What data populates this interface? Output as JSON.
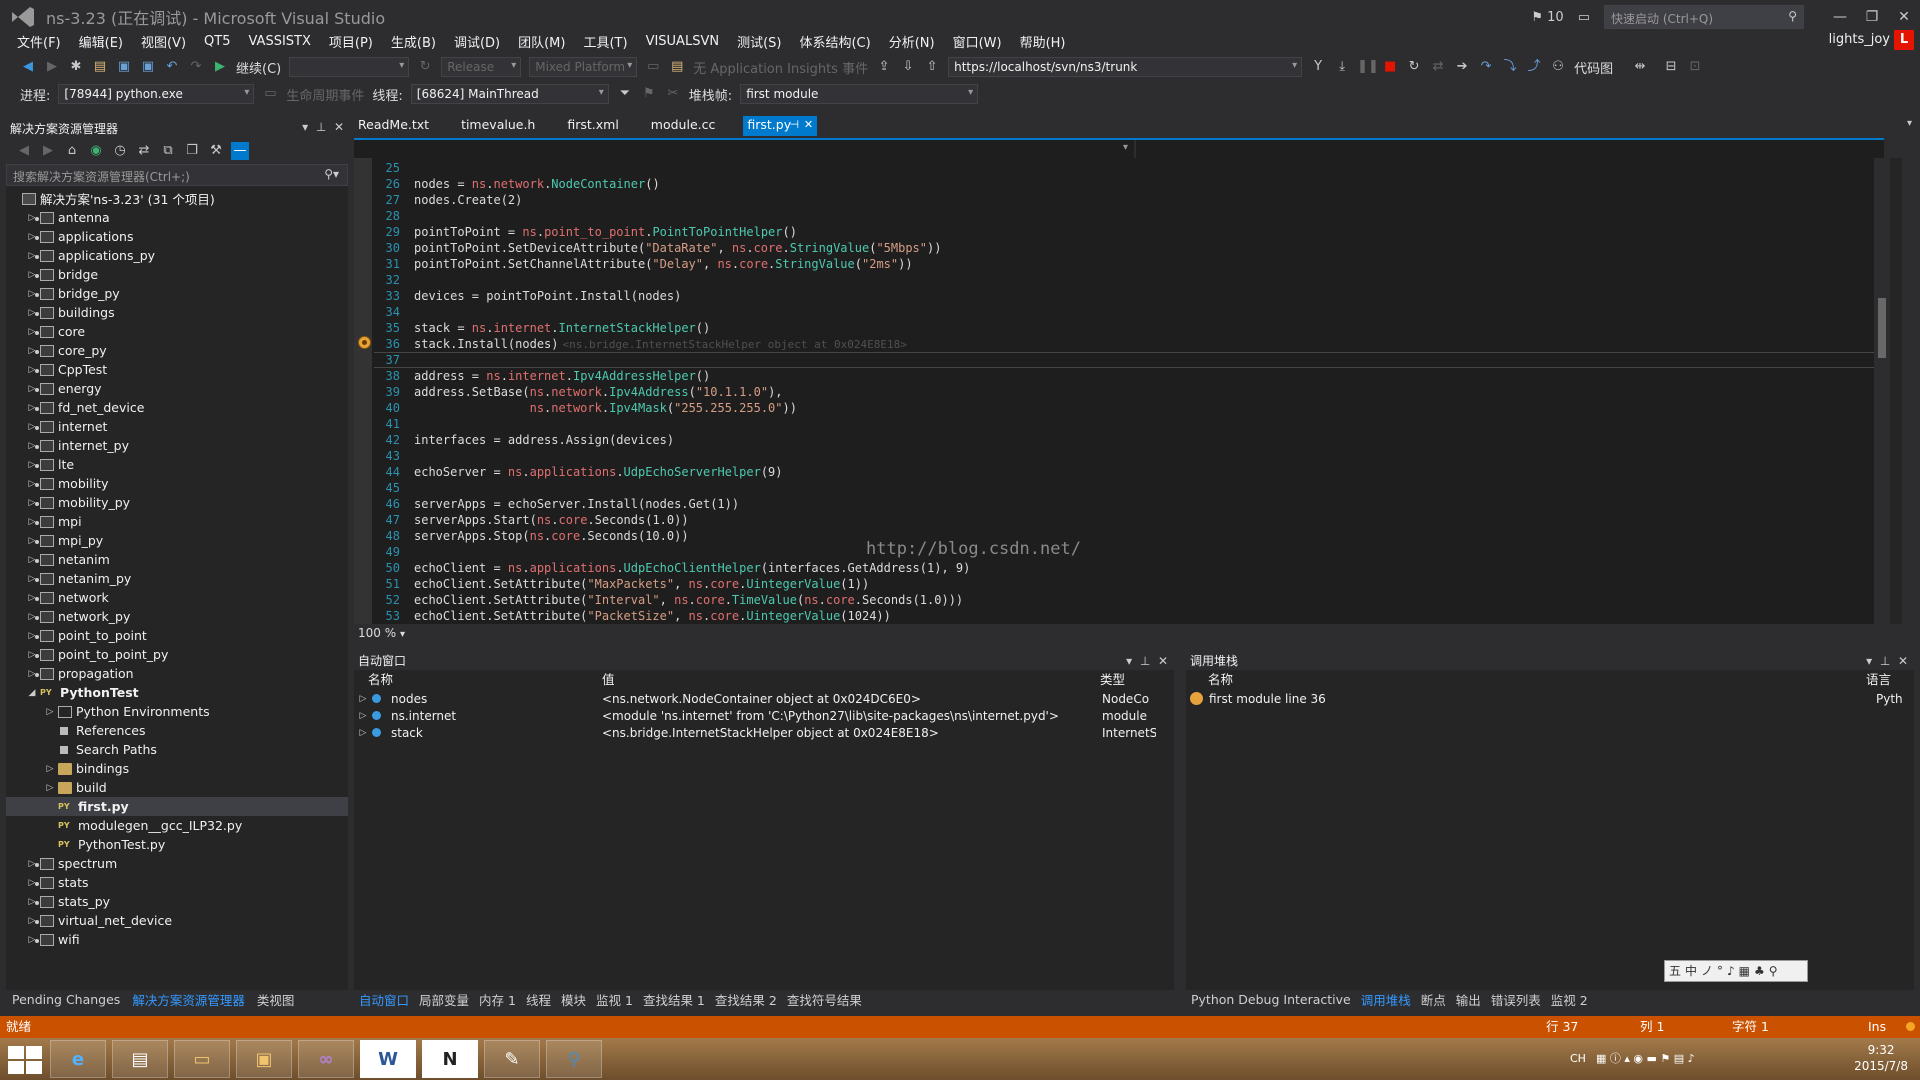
{
  "window": {
    "title": "ns-3.23 (正在调试) - Microsoft Visual Studio",
    "notifications": "10",
    "quick_launch_placeholder": "快速启动 (Ctrl+Q)",
    "user": "lights_joy",
    "user_badge": "L"
  },
  "menu": [
    "文件(F)",
    "编辑(E)",
    "视图(V)",
    "QT5",
    "VASSISTX",
    "项目(P)",
    "生成(B)",
    "调试(D)",
    "团队(M)",
    "工具(T)",
    "VISUALSVN",
    "测试(S)",
    "体系结构(C)",
    "分析(N)",
    "窗口(W)",
    "帮助(H)"
  ],
  "toolbar1": {
    "continue_label": "继续(C)",
    "config": "Release",
    "platform": "Mixed Platform",
    "insights": "无 Application Insights 事件",
    "svn_url": "https://localhost/svn/ns3/trunk",
    "code_map": "代码图"
  },
  "toolbar2": {
    "process_label": "进程:",
    "process_value": "[78944] python.exe",
    "lifecycle": "生命周期事件",
    "thread_label": "线程:",
    "thread_value": "[68624] MainThread",
    "stackframe_label": "堆栈帧:",
    "stackframe_value": "first module"
  },
  "solution_explorer": {
    "title": "解决方案资源管理器",
    "search_placeholder": "搜索解决方案资源管理器(Ctrl+;)",
    "items": [
      {
        "label": "解决方案'ns-3.23' (31 个项目)",
        "level": 0,
        "icon": "sol",
        "exp": ""
      },
      {
        "label": "antenna",
        "level": 1,
        "icon": "proj",
        "exp": "▷"
      },
      {
        "label": "applications",
        "level": 1,
        "icon": "proj",
        "exp": "▷"
      },
      {
        "label": "applications_py",
        "level": 1,
        "icon": "proj",
        "exp": "▷"
      },
      {
        "label": "bridge",
        "level": 1,
        "icon": "proj",
        "exp": "▷"
      },
      {
        "label": "bridge_py",
        "level": 1,
        "icon": "proj",
        "exp": "▷"
      },
      {
        "label": "buildings",
        "level": 1,
        "icon": "proj",
        "exp": "▷"
      },
      {
        "label": "core",
        "level": 1,
        "icon": "proj",
        "exp": "▷"
      },
      {
        "label": "core_py",
        "level": 1,
        "icon": "proj",
        "exp": "▷"
      },
      {
        "label": "CppTest",
        "level": 1,
        "icon": "proj",
        "exp": "▷"
      },
      {
        "label": "energy",
        "level": 1,
        "icon": "proj",
        "exp": "▷"
      },
      {
        "label": "fd_net_device",
        "level": 1,
        "icon": "proj",
        "exp": "▷"
      },
      {
        "label": "internet",
        "level": 1,
        "icon": "proj",
        "exp": "▷"
      },
      {
        "label": "internet_py",
        "level": 1,
        "icon": "proj",
        "exp": "▷"
      },
      {
        "label": "lte",
        "level": 1,
        "icon": "proj",
        "exp": "▷"
      },
      {
        "label": "mobility",
        "level": 1,
        "icon": "proj",
        "exp": "▷"
      },
      {
        "label": "mobility_py",
        "level": 1,
        "icon": "proj",
        "exp": "▷"
      },
      {
        "label": "mpi",
        "level": 1,
        "icon": "proj",
        "exp": "▷"
      },
      {
        "label": "mpi_py",
        "level": 1,
        "icon": "proj",
        "exp": "▷"
      },
      {
        "label": "netanim",
        "level": 1,
        "icon": "proj",
        "exp": "▷"
      },
      {
        "label": "netanim_py",
        "level": 1,
        "icon": "proj",
        "exp": "▷"
      },
      {
        "label": "network",
        "level": 1,
        "icon": "proj",
        "exp": "▷"
      },
      {
        "label": "network_py",
        "level": 1,
        "icon": "proj",
        "exp": "▷"
      },
      {
        "label": "point_to_point",
        "level": 1,
        "icon": "proj",
        "exp": "▷"
      },
      {
        "label": "point_to_point_py",
        "level": 1,
        "icon": "proj",
        "exp": "▷"
      },
      {
        "label": "propagation",
        "level": 1,
        "icon": "proj",
        "exp": "▷"
      },
      {
        "label": "PythonTest",
        "level": 1,
        "icon": "py",
        "exp": "◢",
        "bold": true
      },
      {
        "label": "Python Environments",
        "level": 2,
        "icon": "env",
        "exp": "▷"
      },
      {
        "label": "References",
        "level": 2,
        "icon": "ref",
        "exp": ""
      },
      {
        "label": "Search Paths",
        "level": 2,
        "icon": "ref",
        "exp": ""
      },
      {
        "label": "bindings",
        "level": 2,
        "icon": "folder",
        "exp": "▷"
      },
      {
        "label": "build",
        "level": 2,
        "icon": "folder",
        "exp": "▷"
      },
      {
        "label": "first.py",
        "level": 2,
        "icon": "py",
        "exp": "",
        "bold": true,
        "selected": true
      },
      {
        "label": "modulegen__gcc_ILP32.py",
        "level": 2,
        "icon": "py",
        "exp": ""
      },
      {
        "label": "PythonTest.py",
        "level": 2,
        "icon": "py",
        "exp": ""
      },
      {
        "label": "spectrum",
        "level": 1,
        "icon": "proj",
        "exp": "▷"
      },
      {
        "label": "stats",
        "level": 1,
        "icon": "proj",
        "exp": "▷"
      },
      {
        "label": "stats_py",
        "level": 1,
        "icon": "proj",
        "exp": "▷"
      },
      {
        "label": "virtual_net_device",
        "level": 1,
        "icon": "proj",
        "exp": "▷"
      },
      {
        "label": "wifi",
        "level": 1,
        "icon": "proj",
        "exp": "▷"
      }
    ],
    "tabs": [
      "Pending Changes",
      "解决方案资源管理器",
      "类视图"
    ],
    "active_tab": 1
  },
  "editor": {
    "tabs": [
      "ReadMe.txt",
      "timevalue.h",
      "first.xml",
      "module.cc",
      "first.py"
    ],
    "active_tab": 4,
    "zoom": "100 %",
    "current_line": 36,
    "tooltip": "<ns.bridge.InternetStackHelper object at 0x024E8E18>",
    "watermark": "http://blog.csdn.net/",
    "lines": [
      {
        "n": "25",
        "t": ""
      },
      {
        "n": "26",
        "t": "nodes = ns.network.NodeContainer()"
      },
      {
        "n": "27",
        "t": "nodes.Create(2)"
      },
      {
        "n": "28",
        "t": ""
      },
      {
        "n": "29",
        "t": "pointToPoint = ns.point_to_point.PointToPointHelper()"
      },
      {
        "n": "30",
        "t": "pointToPoint.SetDeviceAttribute(\"DataRate\", ns.core.StringValue(\"5Mbps\"))"
      },
      {
        "n": "31",
        "t": "pointToPoint.SetChannelAttribute(\"Delay\", ns.core.StringValue(\"2ms\"))"
      },
      {
        "n": "32",
        "t": ""
      },
      {
        "n": "33",
        "t": "devices = pointToPoint.Install(nodes)"
      },
      {
        "n": "34",
        "t": ""
      },
      {
        "n": "35",
        "t": "stack = ns.internet.InternetStackHelper()"
      },
      {
        "n": "36",
        "t": "stack.Install(nodes)"
      },
      {
        "n": "37",
        "t": ""
      },
      {
        "n": "38",
        "t": "address = ns.internet.Ipv4AddressHelper()"
      },
      {
        "n": "39",
        "t": "address.SetBase(ns.network.Ipv4Address(\"10.1.1.0\"),"
      },
      {
        "n": "40",
        "t": "                ns.network.Ipv4Mask(\"255.255.255.0\"))"
      },
      {
        "n": "41",
        "t": ""
      },
      {
        "n": "42",
        "t": "interfaces = address.Assign(devices)"
      },
      {
        "n": "43",
        "t": ""
      },
      {
        "n": "44",
        "t": "echoServer = ns.applications.UdpEchoServerHelper(9)"
      },
      {
        "n": "45",
        "t": ""
      },
      {
        "n": "46",
        "t": "serverApps = echoServer.Install(nodes.Get(1))"
      },
      {
        "n": "47",
        "t": "serverApps.Start(ns.core.Seconds(1.0))"
      },
      {
        "n": "48",
        "t": "serverApps.Stop(ns.core.Seconds(10.0))"
      },
      {
        "n": "49",
        "t": ""
      },
      {
        "n": "50",
        "t": "echoClient = ns.applications.UdpEchoClientHelper(interfaces.GetAddress(1), 9)"
      },
      {
        "n": "51",
        "t": "echoClient.SetAttribute(\"MaxPackets\", ns.core.UintegerValue(1))"
      },
      {
        "n": "52",
        "t": "echoClient.SetAttribute(\"Interval\", ns.core.TimeValue(ns.core.Seconds(1.0)))"
      },
      {
        "n": "53",
        "t": "echoClient.SetAttribute(\"PacketSize\", ns.core.UintegerValue(1024))"
      }
    ]
  },
  "autos": {
    "title": "自动窗口",
    "col_name": "名称",
    "col_value": "值",
    "col_type": "类型",
    "rows": [
      {
        "name": "nodes",
        "value": "<ns.network.NodeContainer object at 0x024DC6E0>",
        "type": "NodeCo"
      },
      {
        "name": "ns.internet",
        "value": "<module 'ns.internet' from 'C:\\Python27\\lib\\site-packages\\ns\\internet.pyd'>",
        "type": "module"
      },
      {
        "name": "stack",
        "value": "<ns.bridge.InternetStackHelper object at 0x024E8E18>",
        "type": "InternetS"
      }
    ],
    "tabs": [
      "自动窗口",
      "局部变量",
      "内存 1",
      "线程",
      "模块",
      "监视 1",
      "查找结果 1",
      "查找结果 2",
      "查找符号结果"
    ],
    "active_tab": 0
  },
  "callstack": {
    "title": "调用堆栈",
    "col_name": "名称",
    "col_lang": "语言",
    "rows": [
      {
        "name": "first module line 36",
        "lang": "Pyth"
      }
    ],
    "tabs": [
      "Python Debug Interactive",
      "调用堆栈",
      "断点",
      "输出",
      "错误列表",
      "监视 2"
    ],
    "active_tab": 1
  },
  "ime_bar": "五中ノ°♪▦♣⚲",
  "status": {
    "ready": "就绪",
    "row": "行 37",
    "col": "列 1",
    "char": "字符 1",
    "mode": "Ins"
  },
  "taskbar": {
    "apps": [
      "ie",
      "explorer-pc",
      "folder",
      "files",
      "visual-studio",
      "word",
      "onenote",
      "paint",
      "python"
    ],
    "tray_lang": "CH",
    "time": "9:32",
    "date": "2015/7/8"
  },
  "colors": {
    "accent": "#007acc",
    "status": "#ca5100",
    "keyword_ns": "#e07070",
    "string": "#d69d85",
    "class": "#4ec9b0"
  }
}
